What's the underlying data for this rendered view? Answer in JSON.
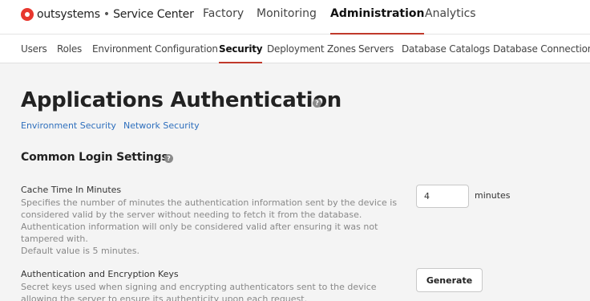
{
  "brand": {
    "name": "outsystems",
    "separator": "•",
    "product": "Service Center",
    "accent": "#e8372e"
  },
  "main_nav": [
    {
      "label": "Factory",
      "active": false
    },
    {
      "label": "Monitoring",
      "active": false
    },
    {
      "label": "Administration",
      "active": true
    },
    {
      "label": "Analytics",
      "active": false
    }
  ],
  "sub_nav": [
    {
      "label": "Users",
      "active": false
    },
    {
      "label": "Roles",
      "active": false
    },
    {
      "label": "Environment Configuration",
      "active": false
    },
    {
      "label": "Security",
      "active": true
    },
    {
      "label": "Deployment Zones",
      "active": false
    },
    {
      "label": "Servers",
      "active": false
    },
    {
      "label": "Database Catalogs",
      "active": false
    },
    {
      "label": "Database Connections",
      "active": false
    }
  ],
  "page": {
    "title": "Applications Authentication",
    "help_glyph": "?",
    "links": [
      "Environment Security",
      "Network Security"
    ]
  },
  "section": {
    "title": "Common Login Settings",
    "help_glyph": "?"
  },
  "settings": {
    "cache_time": {
      "label": "Cache Time In Minutes",
      "description": "Specifies the number of minutes the authentication information sent by the device is considered valid by the server without needing to fetch it from the database. Authentication information will only be considered valid after ensuring it was not tampered with.",
      "default_note": "Default value is 5 minutes.",
      "value": "4",
      "unit": "minutes"
    },
    "keys": {
      "label": "Authentication and Encryption Keys",
      "description": "Secret keys used when signing and encrypting authenticators sent to the device allowing the server to ensure its authenticity upon each request.",
      "button_label": "Generate"
    }
  }
}
